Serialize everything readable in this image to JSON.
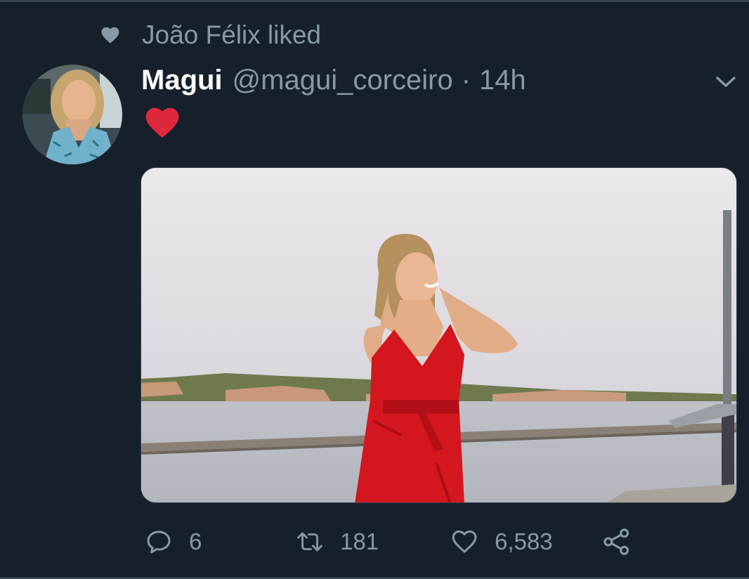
{
  "context": {
    "icon": "heart-icon",
    "text": "João Félix liked"
  },
  "tweet": {
    "display_name": "Magui",
    "handle": "@magui_corceiro",
    "separator": "·",
    "time": "14h",
    "text_emoji": "red-heart-emoji",
    "media_description_icon": "photo"
  },
  "actions": {
    "reply_count": "6",
    "retweet_count": "181",
    "like_count": "6,583"
  },
  "colors": {
    "background": "#15202b",
    "secondary_text": "#8899a6",
    "primary_text": "#ffffff",
    "heart_red": "#e0245e",
    "divider": "#38444d"
  }
}
